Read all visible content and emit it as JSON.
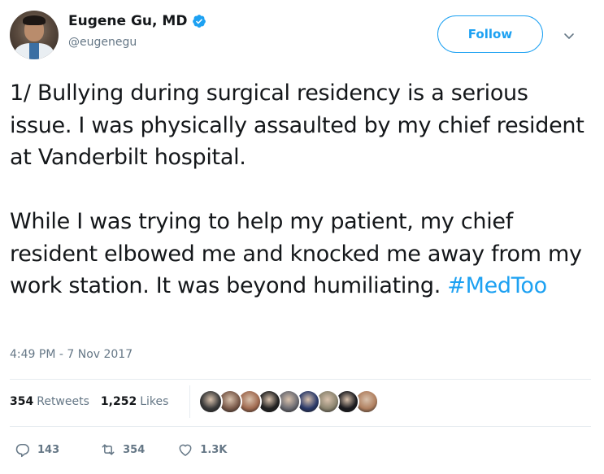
{
  "author": {
    "display_name": "Eugene Gu, MD",
    "handle": "@eugenegu",
    "verified": true
  },
  "follow_label": "Follow",
  "tweet": {
    "paragraphs": [
      "1/ Bullying during surgical residency is a serious issue. I was physically assaulted by my chief resident at Vanderbilt hospital.",
      "While I was trying to help my patient, my chief resident elbowed me and knocked me away from my work station. It was beyond humiliating."
    ],
    "hashtag": "#MedToo",
    "timestamp": "4:49 PM - 7 Nov 2017"
  },
  "stats": {
    "retweets_count": "354",
    "retweets_label": "Retweets",
    "likes_count": "1,252",
    "likes_label": "Likes"
  },
  "likers": [
    {
      "color": "#3a3a3a"
    },
    {
      "color": "#7a5a4a"
    },
    {
      "color": "#a06a50"
    },
    {
      "color": "#222222"
    },
    {
      "color": "#6b6b72"
    },
    {
      "color": "#2b3a6a"
    },
    {
      "color": "#8c8570"
    },
    {
      "color": "#1c1c20"
    },
    {
      "color": "#b08060"
    }
  ],
  "actions": {
    "replies": "143",
    "retweets": "354",
    "likes": "1.3K"
  },
  "colors": {
    "accent": "#1da1f2",
    "muted": "#657786",
    "text": "#14171a"
  }
}
